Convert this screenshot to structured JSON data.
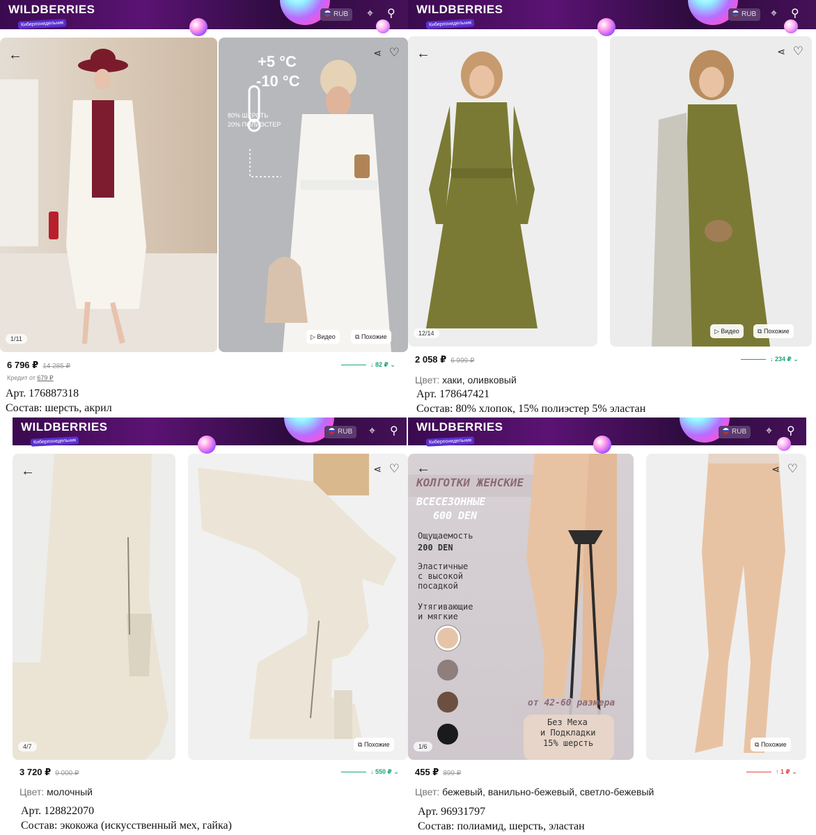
{
  "common": {
    "brand": "WILDBERRIES",
    "promo_tag": "Киберпонедельник",
    "currency": "RUB",
    "video_label": "Видео",
    "similar_label": "Похожие",
    "color_label": "Цвет:",
    "colors": {
      "header_from": "#3a0a4f",
      "header_to": "#451057",
      "price_down": "#1fa27a",
      "price_up": "#e64646"
    }
  },
  "products": [
    {
      "name": "coat",
      "counter": "1/11",
      "price": "6 796 ₽",
      "old_price": "14 285 ₽",
      "trend_text": "↓ 82 ₽",
      "trend_direction": "down",
      "credit_label": "Кредит от",
      "credit_value": "679 ₽",
      "article": "Арт. 176887318",
      "composition": "Состав: шерсть, акрил",
      "overlay": {
        "temp_high": "+5 °C",
        "temp_low": "-10 °C",
        "fabric_1": "80% ШЕРСТЬ",
        "fabric_2": "20% ПОЛИЭСТЕР"
      }
    },
    {
      "name": "dress",
      "counter": "12/14",
      "price": "2 058 ₽",
      "old_price": "6 999 ₽",
      "trend_text": "↓ 234 ₽",
      "trend_direction": "down",
      "color_value": "хаки, оливковый",
      "article": "Арт. 178647421",
      "composition": "Состав: 80% хлопок, 15% полиэстер 5% эластан"
    },
    {
      "name": "boots",
      "counter": "4/7",
      "price": "3 720 ₽",
      "old_price": "9 000 ₽",
      "trend_text": "↓ 550 ₽",
      "trend_direction": "down",
      "color_value": "молочный",
      "article": "Арт. 128822070",
      "composition": "Состав: экокожа (искусственный мех, гайка)"
    },
    {
      "name": "tights",
      "counter": "1/6",
      "price": "455 ₽",
      "old_price": "899 ₽",
      "trend_text": "↑ 1 ₽",
      "trend_direction": "up",
      "color_value": "бежевый, ванильно-бежевый, светло-бежевый",
      "article": "Арт. 96931797",
      "composition": "Состав: полиамид, шерсть, эластан",
      "overlay": {
        "title": "КОЛГОТКИ ЖЕНСКИЕ",
        "subtitle_1": "ВСЕСЕЗОННЫЕ",
        "subtitle_2": "600 DEN",
        "feature_1a": "Ощущаемость",
        "feature_1b": "200 DEN",
        "feature_2a": "Эластичные",
        "feature_2b": "с высокой",
        "feature_2c": "посадкой",
        "feature_3a": "Утягивающие",
        "feature_3b": "и мягкие",
        "sizes": "от 42-60 размера",
        "badge_1": "Без Меха",
        "badge_2": "и Подкладки",
        "badge_3": "15% шерсть",
        "swatches": [
          "#e6c4a8",
          "#8e7f7c",
          "#6d4f40",
          "#1a1a1a"
        ]
      }
    }
  ]
}
